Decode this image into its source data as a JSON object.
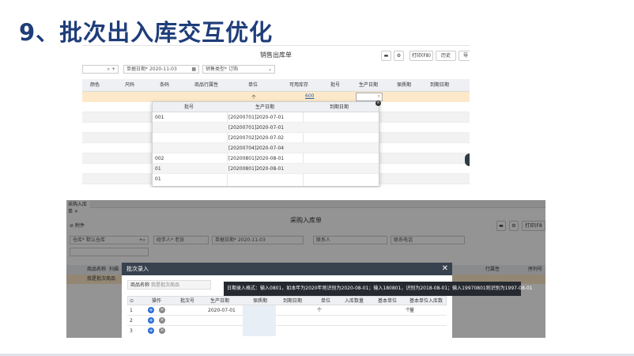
{
  "slide": {
    "title": "9、批次出入库交互优化"
  },
  "top_ui": {
    "form_title": "销售出库单",
    "toolbar": {
      "print": "打印(F8)",
      "history": "历史",
      "import": "导"
    },
    "fields": {
      "date_label": "单据日期",
      "date_value": "2020-11-03",
      "sales_type_label": "销售类型",
      "sales_type_value": "订购"
    },
    "columns": [
      "颜色",
      "尺码",
      "条码",
      "商品行属性",
      "单位",
      "可用库存",
      "批号",
      "生产日期",
      "保质期",
      "到期日期"
    ],
    "active_row": {
      "unit": "个",
      "stock": "600"
    },
    "dropdown": {
      "columns": [
        "批号",
        "生产日期",
        "到期日期"
      ],
      "rows": [
        {
          "batch": "001",
          "prod": "[20200701]2020-07-01"
        },
        {
          "batch": "",
          "prod": "[20200701]2020-07-01"
        },
        {
          "batch": "",
          "prod": "[20200702]2020-07-02"
        },
        {
          "batch": "",
          "prod": "[20200704]2020-07-04"
        },
        {
          "batch": "002",
          "prod": "[20200801]2020-08-01"
        },
        {
          "batch": "01",
          "prod": "[20200801]2020-08-01"
        },
        {
          "batch": "01",
          "prod": ""
        }
      ]
    }
  },
  "bottom_ui": {
    "tab": "采购入库单",
    "form_title": "采购入库单",
    "attach": "附件",
    "toolbar": {
      "print": "打印(F8"
    },
    "fields": {
      "warehouse_label": "仓库",
      "warehouse_value": "默认仓库",
      "handler_label": "经手人",
      "handler_value": "老张",
      "date_label": "单据日期",
      "date_value": "2020-11-03",
      "contact": "联系人",
      "phone": "联系电话"
    },
    "bg_columns": {
      "product_name": "商品名称",
      "scan": "扫描",
      "row_attr": "行属性",
      "serial": "序列号"
    },
    "bg_row": {
      "product": "我是批次商品"
    },
    "dialog": {
      "title": "批次录入",
      "product_label": "商品名称",
      "product_value": "我是批次商品",
      "tooltip": "日期录入格式：输入0801，如本年为2020年则识别为2020-08-01；输入180801，识别为2018-08-01；输入19970801则识别为1997-08-01",
      "columns": [
        "操作",
        "批次号",
        "生产日期",
        "保质期",
        "到期日期",
        "单位",
        "入库数量",
        "基本单位",
        "基本单位入库数量"
      ],
      "rows": [
        {
          "no": "1",
          "prod": "2020-07-01",
          "unit": "个",
          "base_unit": "个"
        },
        {
          "no": "2",
          "prod": "",
          "unit": "",
          "base_unit": ""
        },
        {
          "no": "3",
          "prod": "",
          "unit": "",
          "base_unit": ""
        }
      ]
    }
  }
}
